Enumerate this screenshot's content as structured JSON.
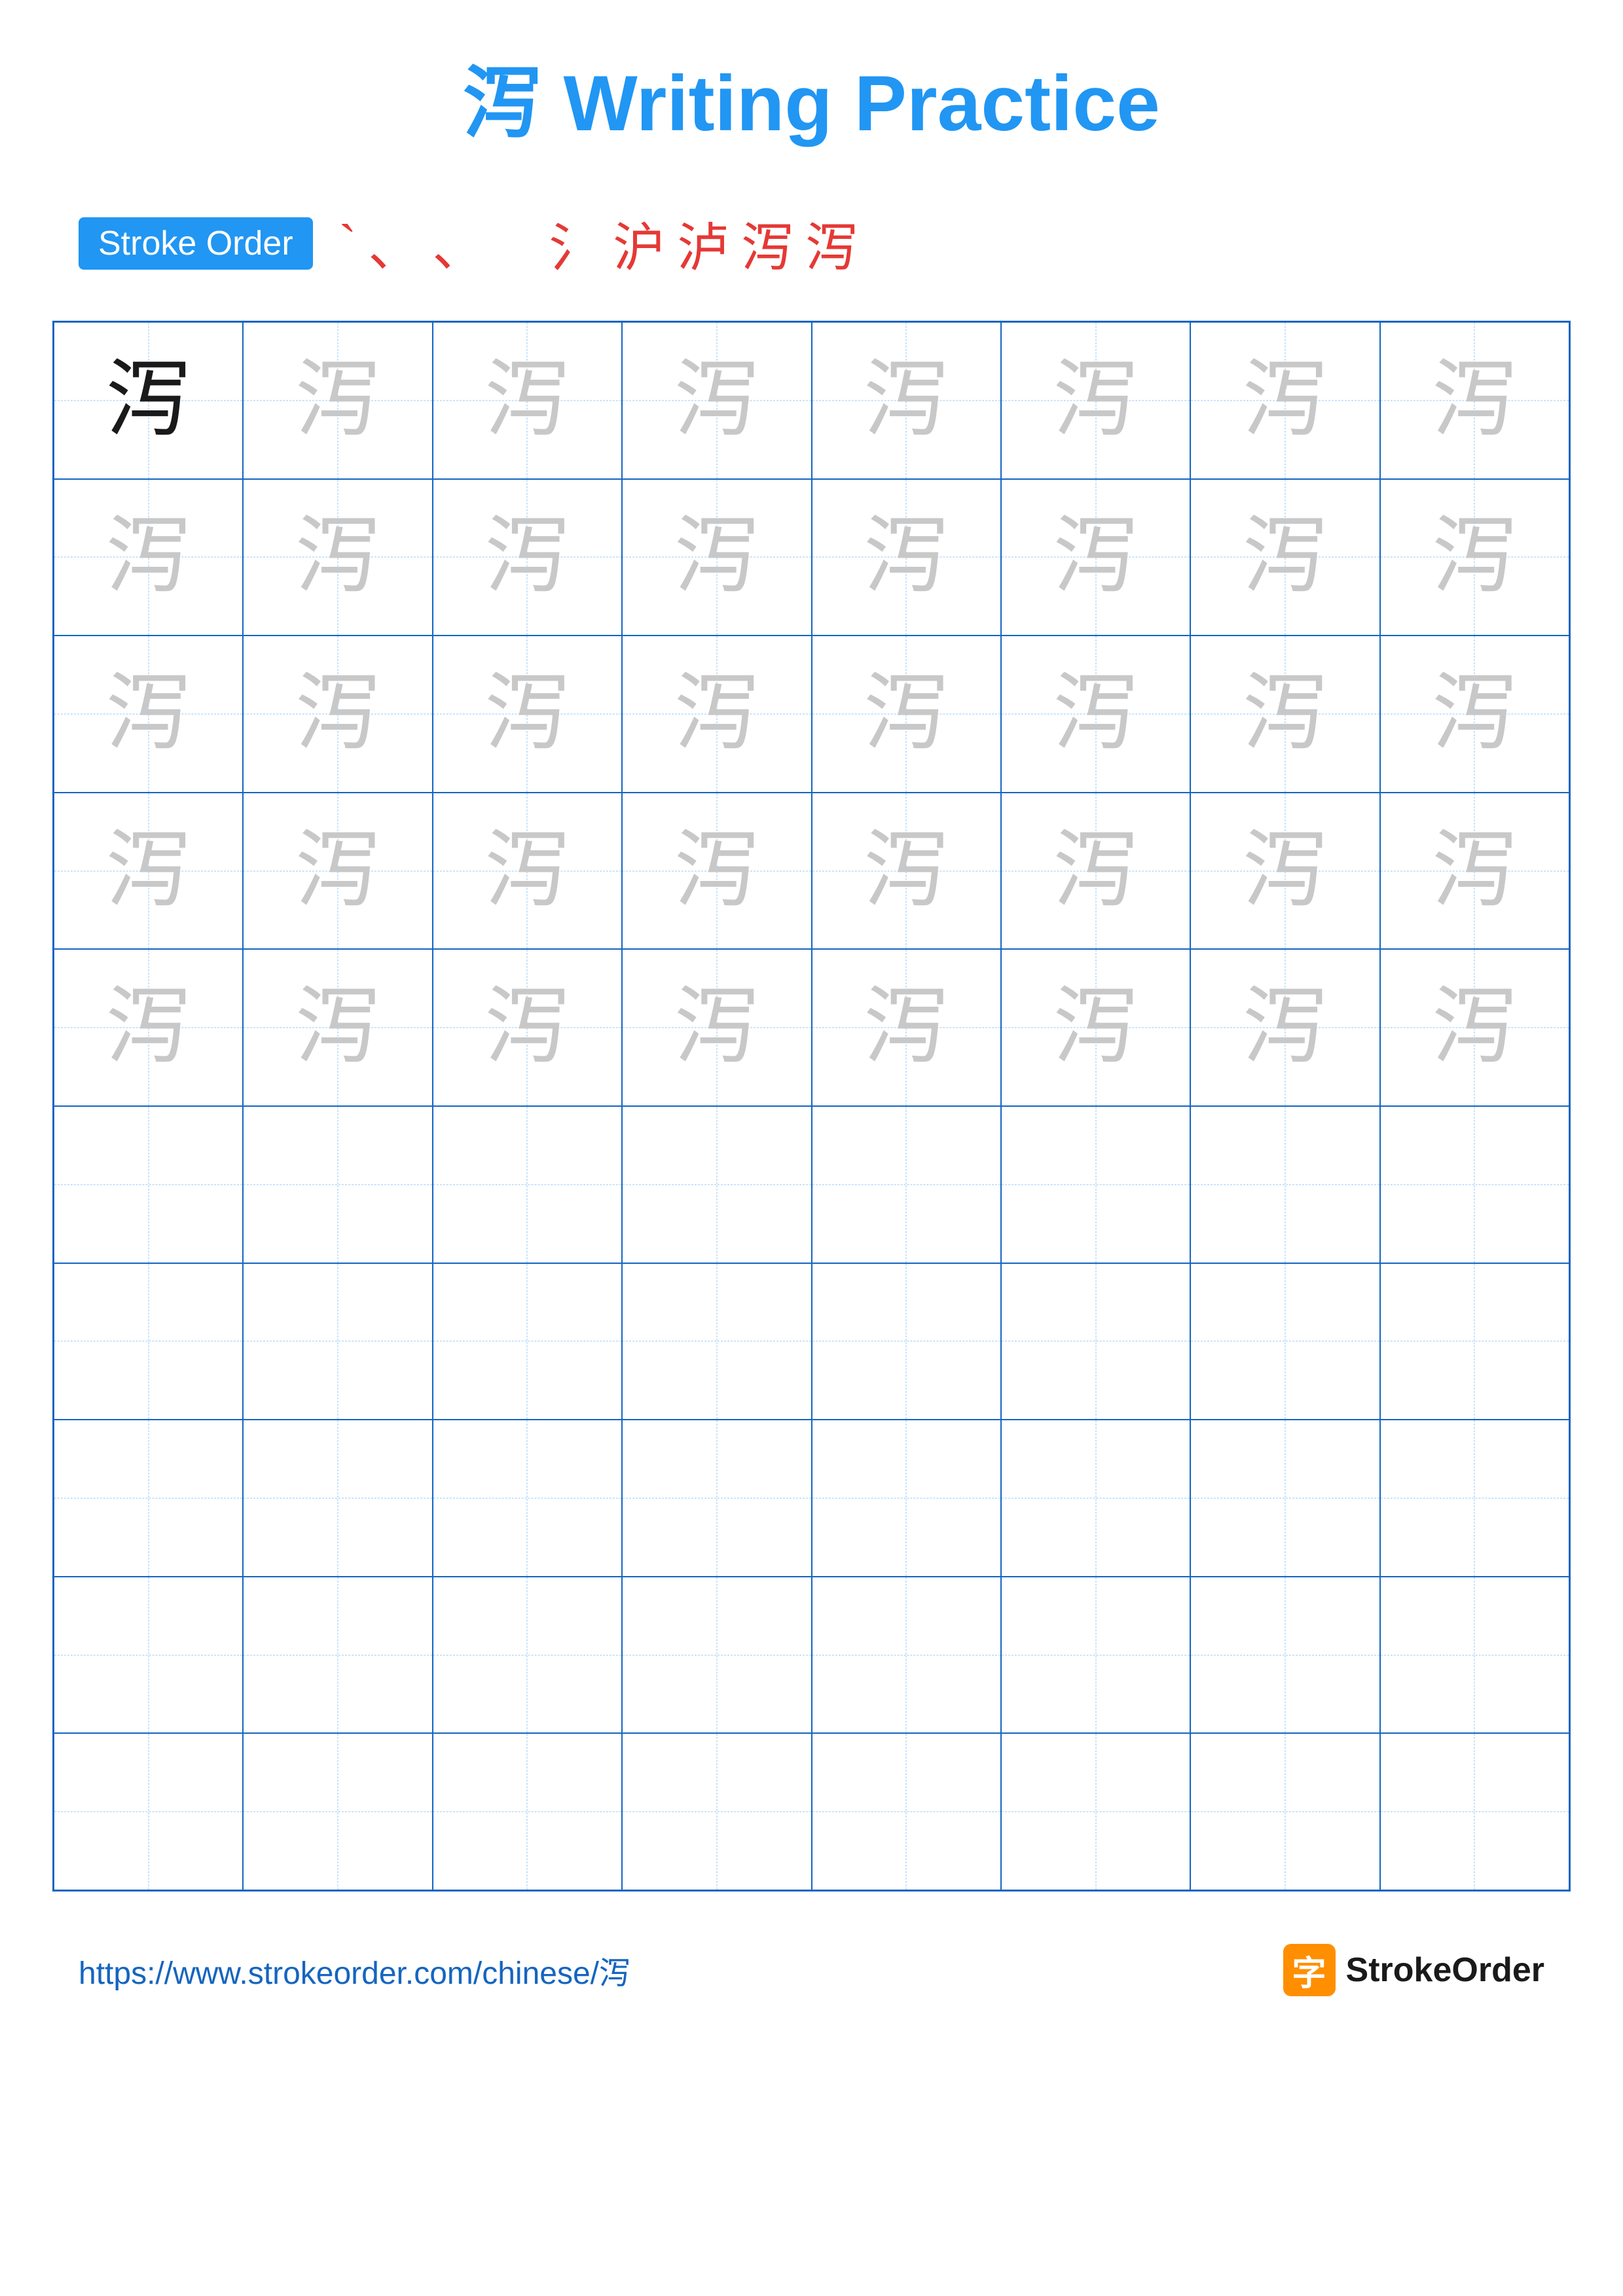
{
  "title": "泻 Writing Practice",
  "character": "泻",
  "stroke_order_label": "Stroke Order",
  "stroke_order_chars": [
    "`",
    "ˋ",
    "氵",
    "氵",
    "沪",
    "泸",
    "泻",
    "泻"
  ],
  "footer_url": "https://www.strokeorder.com/chinese/泻",
  "footer_brand": "StrokeOrder",
  "footer_icon_char": "字",
  "grid": {
    "cols": 8,
    "rows": 10,
    "chars_row1": [
      "泻",
      "泻",
      "泻",
      "泻",
      "泻",
      "泻",
      "泻",
      "泻"
    ],
    "chars_rows_light": "泻"
  }
}
